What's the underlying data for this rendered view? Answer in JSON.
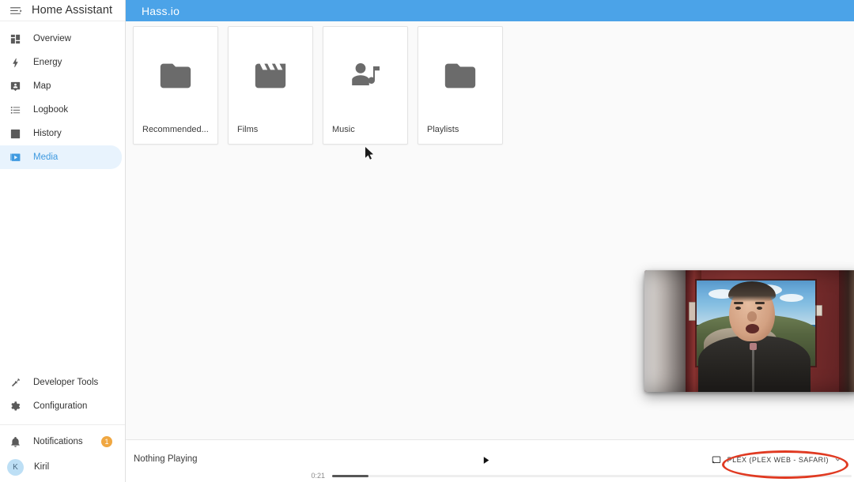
{
  "sidebar": {
    "menu_icon": "menu-open-icon",
    "title": "Home Assistant",
    "items": [
      {
        "label": "Overview",
        "icon": "view-dashboard-icon",
        "active": false
      },
      {
        "label": "Energy",
        "icon": "lightning-bolt-icon",
        "active": false
      },
      {
        "label": "Map",
        "icon": "map-marker-account-icon",
        "active": false
      },
      {
        "label": "Logbook",
        "icon": "format-list-bulleted-icon",
        "active": false
      },
      {
        "label": "History",
        "icon": "chart-box-icon",
        "active": false
      },
      {
        "label": "Media",
        "icon": "play-box-multiple-icon",
        "active": true
      }
    ],
    "bottom_items": [
      {
        "label": "Developer Tools",
        "icon": "hammer-icon"
      },
      {
        "label": "Configuration",
        "icon": "cog-icon"
      }
    ],
    "notifications": {
      "label": "Notifications",
      "icon": "bell-icon",
      "badge": "1",
      "badge_color": "#f0a741"
    },
    "user": {
      "label": "Kiril",
      "avatar_initial": "K",
      "avatar_color": "#bddff5"
    },
    "active_color": "#3f9ae0",
    "active_bg": "#e8f3fd"
  },
  "topbar": {
    "title": "Hass.io",
    "background": "#4ba3e8"
  },
  "media_browser": {
    "cards": [
      {
        "label": "Recommended...",
        "icon": "folder-icon"
      },
      {
        "label": "Films",
        "icon": "movie-icon"
      },
      {
        "label": "Music",
        "icon": "account-music-icon"
      },
      {
        "label": "Playlists",
        "icon": "folder-icon"
      }
    ]
  },
  "player": {
    "title": "Nothing Playing",
    "play_icon": "play-icon",
    "current_time": "0:21",
    "progress_percent": 7,
    "cast": {
      "icon": "cast-icon",
      "label": "PLEX (PLEX WEB - SAFARI)",
      "chevron": "chevron-down-icon"
    }
  },
  "annotation": {
    "shape": "ellipse",
    "color": "#e03a22",
    "target": "cast-device-selector"
  },
  "pip_video": {
    "description": "webcam-overlay"
  }
}
